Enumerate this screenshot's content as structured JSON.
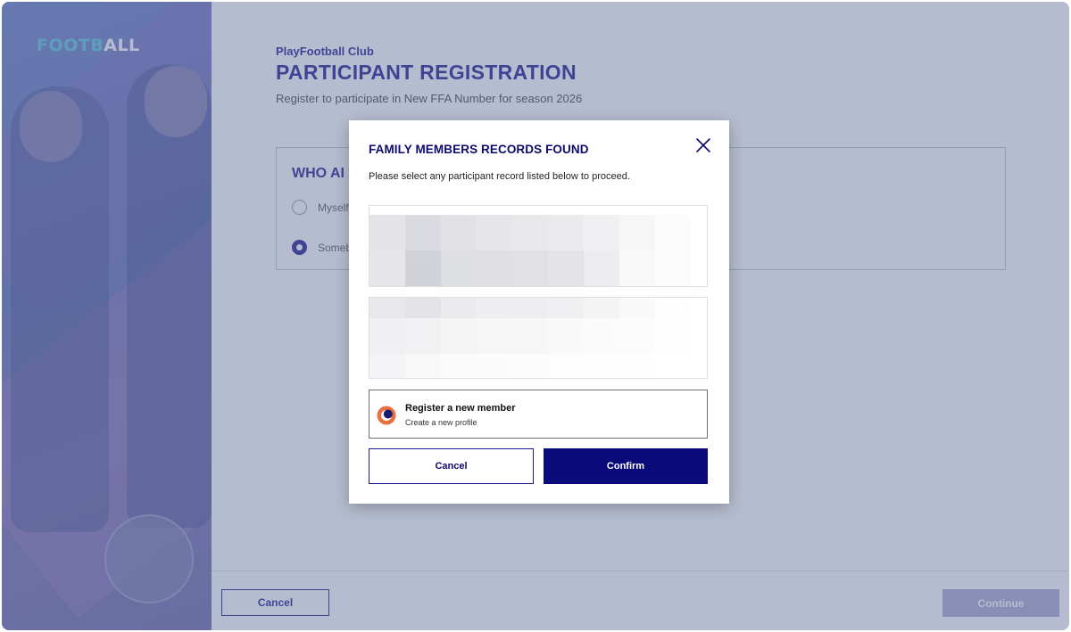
{
  "brand": {
    "logo_part1": "FOOTB",
    "logo_part2": "ALL"
  },
  "page": {
    "org_name": "PlayFootball Club",
    "title": "PARTICIPANT REGISTRATION",
    "subtitle": "Register to participate in New FFA Number for season 2026",
    "who_heading": "WHO AI",
    "options": [
      {
        "label": "Myself",
        "selected": false
      },
      {
        "label": "Someb",
        "selected": true
      }
    ],
    "footer": {
      "cancel_label": "Cancel",
      "continue_label": "Continue"
    }
  },
  "modal": {
    "title": "FAMILY MEMBERS RECORDS FOUND",
    "description": "Please select any participant record listed below to proceed.",
    "new_member": {
      "title": "Register a new member",
      "subtitle": "Create a new profile"
    },
    "cancel_label": "Cancel",
    "confirm_label": "Confirm"
  },
  "colors": {
    "brand_navy": "#0b0a7a",
    "accent_cyan": "#58c4d8",
    "new_member_icon": "#e9703e"
  },
  "icons": {
    "close": "close-icon",
    "new_member": "new-member-icon",
    "radio": "radio-icon"
  }
}
